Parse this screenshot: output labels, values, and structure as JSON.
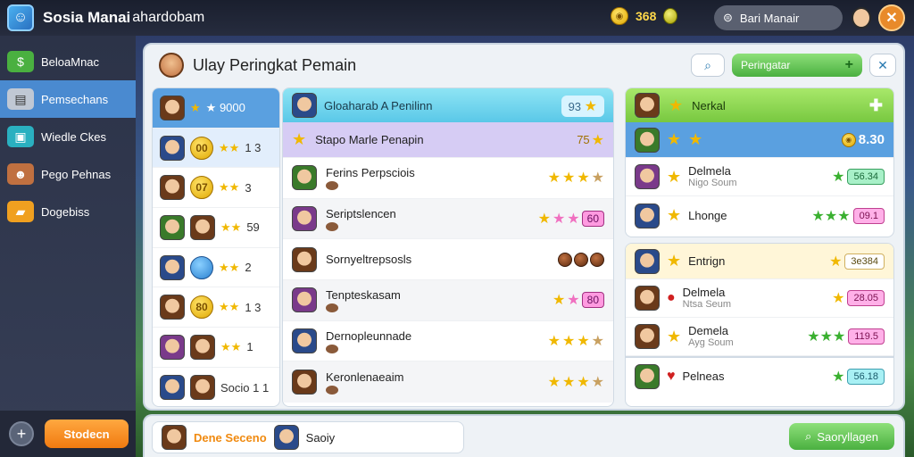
{
  "app": {
    "title": "Sosia Manai",
    "subtitle": "ahardobam",
    "coins": "368",
    "search_label": "Bari Manair"
  },
  "sidebar": {
    "items": [
      {
        "label": "BeloaMnac",
        "icon": "money-icon"
      },
      {
        "label": "Pemsechans",
        "icon": "server-icon",
        "active": true
      },
      {
        "label": "Wiedle Ckes",
        "icon": "tablet-icon"
      },
      {
        "label": "Pego Pehnas",
        "icon": "character-icon"
      },
      {
        "label": "Dogebiss",
        "icon": "folder-icon"
      }
    ],
    "bottom_button": "Stodecn"
  },
  "panel": {
    "title": "Ulay Peringkat Pemain",
    "filter_label": "Peringatar"
  },
  "col1": {
    "rows": [
      {
        "rank": "",
        "score": "9000",
        "highlight": "blue"
      },
      {
        "rank": "00",
        "score": "1 3",
        "highlight": "light"
      },
      {
        "rank": "07",
        "score": "3"
      },
      {
        "rank": "",
        "score": "59"
      },
      {
        "rank": "",
        "score": "2"
      },
      {
        "rank": "80",
        "score": "1 3"
      },
      {
        "rank": "",
        "score": "1"
      },
      {
        "rank": "",
        "score": "Socio 1 1"
      }
    ]
  },
  "col2": {
    "header": {
      "title": "Gloaharab A Penilinn",
      "value": "93"
    },
    "rows": [
      {
        "name": "Stapo Marle Penapin",
        "value": "75",
        "style": "purple"
      },
      {
        "name": "Ferins Perpsciois"
      },
      {
        "name": "Seriptslencen",
        "style": "grey",
        "tag": "60"
      },
      {
        "name": "Sornyeltrepsosls"
      },
      {
        "name": "Tenpteskasam",
        "style": "grey",
        "tag": "80"
      },
      {
        "name": "Dernopleunnade"
      },
      {
        "name": "Keronlenaeaim",
        "style": "grey"
      }
    ]
  },
  "col3": {
    "header": {
      "title": "Nerkal"
    },
    "rows": [
      {
        "name": "",
        "value": "8.30",
        "style": "blue"
      },
      {
        "name": "Delmela",
        "sub": "Nigo Soum",
        "pill": "56.34"
      },
      {
        "name": "Lhonge",
        "pill": "09.1"
      }
    ]
  },
  "col4": {
    "rows": [
      {
        "name": "Entrign",
        "pill": "3e384",
        "style": "cream"
      },
      {
        "name": "Delmela",
        "sub": "Ntsa Seum",
        "pill": "28.05"
      },
      {
        "name": "Demela",
        "sub": "Ayg Soum",
        "pill": "119.5"
      },
      {
        "name": "Pelneas",
        "pill": "56.18"
      }
    ]
  },
  "bottombar": {
    "label": "Dene Seceno",
    "name": "Saoiy",
    "button": "Saoryllagen"
  }
}
